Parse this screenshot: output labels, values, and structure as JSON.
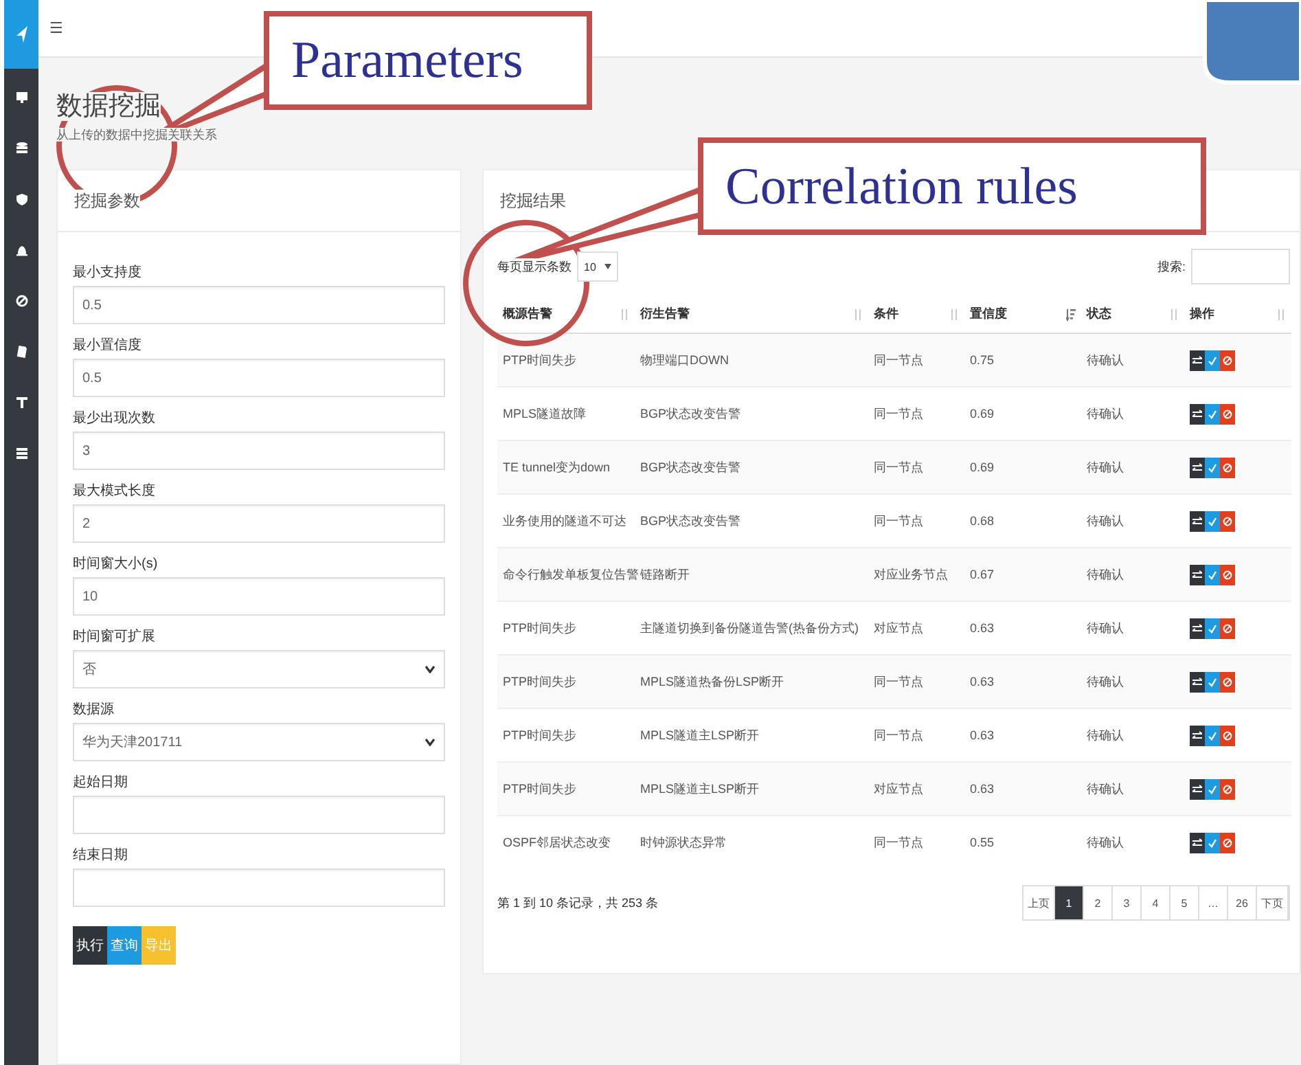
{
  "topbar": {
    "menu": "☰"
  },
  "page": {
    "title": "数据挖掘",
    "subtitle": "从上传的数据中挖掘关联关系"
  },
  "params": {
    "title": "挖掘参数",
    "fields": [
      {
        "kind": "text",
        "label": "最小支持度",
        "value": "0.5"
      },
      {
        "kind": "text",
        "label": "最小置信度",
        "value": "0.5"
      },
      {
        "kind": "text",
        "label": "最少出现次数",
        "value": "3"
      },
      {
        "kind": "text",
        "label": "最大模式长度",
        "value": "2"
      },
      {
        "kind": "text",
        "label": "时间窗大小(s)",
        "value": "10"
      },
      {
        "kind": "select",
        "label": "时间窗可扩展",
        "value": "否"
      },
      {
        "kind": "select",
        "label": "数据源",
        "value": "华为天津201711"
      },
      {
        "kind": "text",
        "label": "起始日期"
      },
      {
        "kind": "text",
        "label": "结束日期"
      }
    ],
    "buttons": [
      {
        "label": "执行"
      },
      {
        "label": "查询"
      },
      {
        "label": "导出"
      }
    ]
  },
  "results": {
    "title": "挖掘结果",
    "page_size_label": "每页显示条数",
    "page_size": "10",
    "search_label": "搜索:",
    "columns": [
      {
        "label": "概源告警",
        "sorted": false
      },
      {
        "label": "衍生告警",
        "sorted": false
      },
      {
        "label": "条件",
        "sorted": false
      },
      {
        "label": "置信度",
        "sorted": true
      },
      {
        "label": "状态",
        "sorted": false
      },
      {
        "label": "操作",
        "sorted": false
      }
    ],
    "rows": [
      [
        "PTP时间失步",
        "物理端口DOWN",
        "同一节点",
        "0.75",
        "待确认"
      ],
      [
        "MPLS隧道故障",
        "BGP状态改变告警",
        "同一节点",
        "0.69",
        "待确认"
      ],
      [
        "TE tunnel变为down",
        "BGP状态改变告警",
        "同一节点",
        "0.69",
        "待确认"
      ],
      [
        "业务使用的隧道不可达",
        "BGP状态改变告警",
        "同一节点",
        "0.68",
        "待确认"
      ],
      [
        "命令行触发单板复位告警",
        "链路断开",
        "对应业务节点",
        "0.67",
        "待确认"
      ],
      [
        "PTP时间失步",
        "主隧道切换到备份隧道告警(热备份方式)",
        "对应节点",
        "0.63",
        "待确认"
      ],
      [
        "PTP时间失步",
        "MPLS隧道热备份LSP断开",
        "同一节点",
        "0.63",
        "待确认"
      ],
      [
        "PTP时间失步",
        "MPLS隧道主LSP断开",
        "同一节点",
        "0.63",
        "待确认"
      ],
      [
        "PTP时间失步",
        "MPLS隧道主LSP断开",
        "对应节点",
        "0.63",
        "待确认"
      ],
      [
        "OSPF邻居状态改变",
        "时钟源状态异常",
        "同一节点",
        "0.55",
        "待确认"
      ]
    ],
    "summary": "第 1 到 10 条记录，共 253 条",
    "pagination": [
      {
        "label": "上页",
        "selected": false
      },
      {
        "label": "1",
        "selected": true
      },
      {
        "label": "2",
        "selected": false
      },
      {
        "label": "3",
        "selected": false
      },
      {
        "label": "4",
        "selected": false
      },
      {
        "label": "5",
        "selected": false
      },
      {
        "label": "…",
        "selected": false
      },
      {
        "label": "26",
        "selected": false
      },
      {
        "label": "下页",
        "selected": false
      }
    ]
  },
  "annotations": [
    {
      "text": "Parameters"
    },
    {
      "text": "Correlation rules"
    }
  ]
}
